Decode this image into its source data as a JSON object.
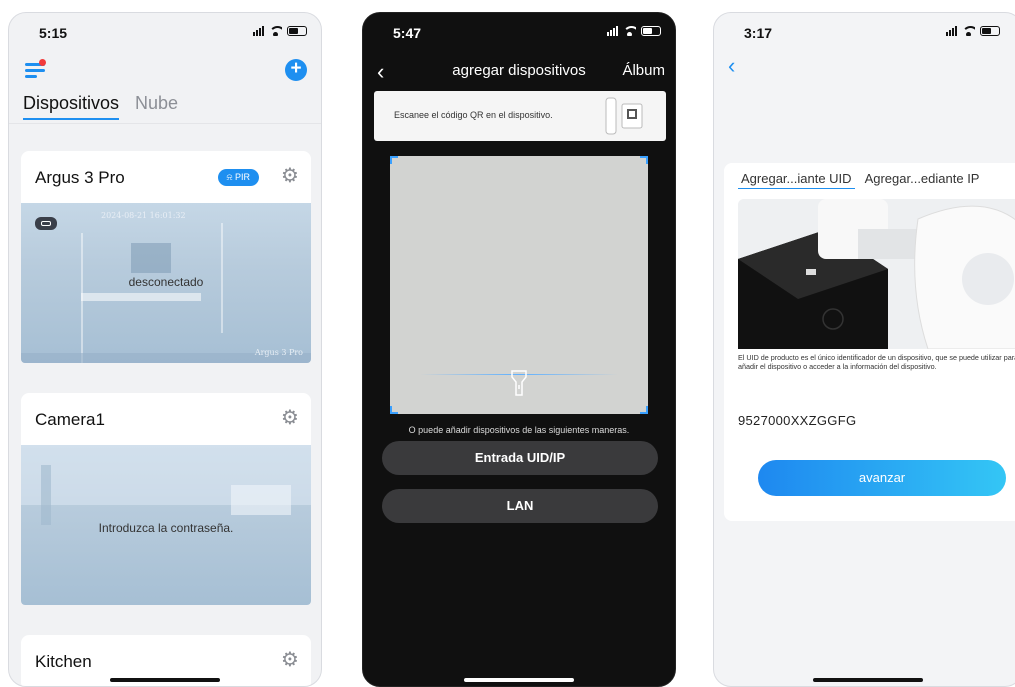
{
  "screen1": {
    "time": "5:15",
    "tabs": [
      {
        "label": "Dispositivos"
      },
      {
        "label": "Nube"
      }
    ],
    "devices": [
      {
        "name": "Argus 3 Pro",
        "badge": "PIR",
        "status": "desconectado",
        "watermark": "Argus 3 Pro",
        "feed_overlay": "2024-08-21 16:01:32"
      },
      {
        "name": "Camera1",
        "status": "Introduzca la contraseña."
      },
      {
        "name": "Kitchen"
      }
    ]
  },
  "screen2": {
    "time": "5:47",
    "title": "agregar dispositivos",
    "album": "Álbum",
    "banner_text": "Escanee el código QR en el dispositivo.",
    "hint": "O puede añadir dispositivos de las siguientes maneras.",
    "buttons": [
      {
        "label": "Entrada UID/IP"
      },
      {
        "label": "LAN"
      }
    ]
  },
  "screen3": {
    "time": "3:17",
    "tabs": [
      {
        "label": "Agregar...iante UID"
      },
      {
        "label": "Agregar...ediante IP"
      }
    ],
    "description": "El UID de producto es el único identificador de un dispositivo, que se puede utilizar para añadir el dispositivo o acceder a la información del dispositivo.",
    "uid": "9527000XXZGGFG",
    "advance_button": "avanzar"
  },
  "colors": {
    "accent": "#1e8ff0",
    "gear": "#8a8d93",
    "dark_bg": "#101010",
    "button_dark": "#3a3a3c"
  },
  "icons": [
    "menu-icon",
    "add-icon",
    "gear-icon",
    "bell-icon",
    "back-icon",
    "flashlight-icon",
    "wifi-icon",
    "battery-icon",
    "signal-icon"
  ]
}
